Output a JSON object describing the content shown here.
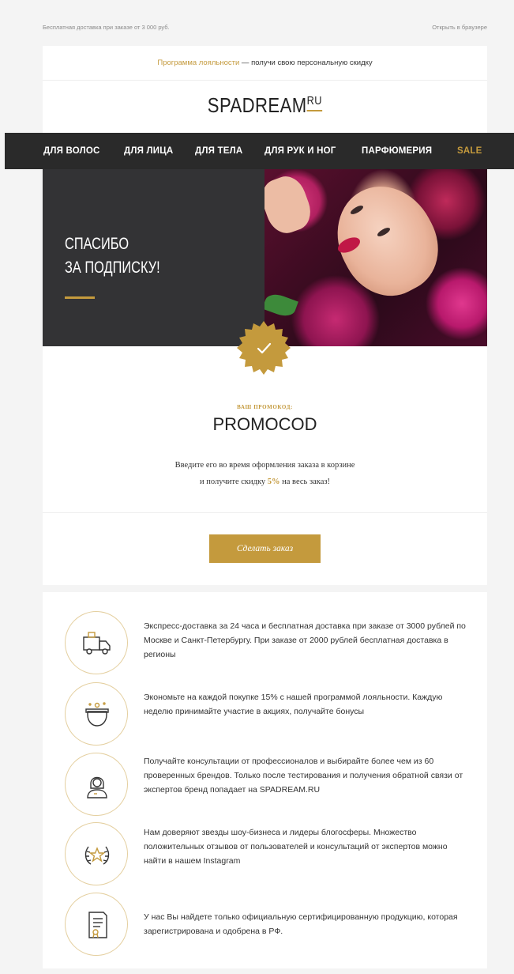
{
  "preheader": {
    "left": "Бесплатная доставка при заказе от 3 000 руб.",
    "right": "Открыть в браузере"
  },
  "loyalty": {
    "link": "Программа лояльности",
    "text": " — получи свою персональную скидку"
  },
  "brand": {
    "name": "SPADREAM",
    "suffix": "RU"
  },
  "nav": {
    "items": [
      "ДЛЯ ВОЛОС",
      "ДЛЯ ЛИЦА",
      "ДЛЯ ТЕЛА",
      "ДЛЯ РУК И НОГ",
      "ПАРФЮМЕРИЯ",
      "SALE"
    ]
  },
  "hero": {
    "line1": "СПАСИБО",
    "line2": "ЗА ПОДПИСКУ!"
  },
  "promo": {
    "label": "ВАШ ПРОМОКОД:",
    "code": "PROMOCOD",
    "text_line1": "Введите его во время оформления заказа в корзине",
    "text_line2_before": "и получите скидку ",
    "discount": "5%",
    "text_line2_after": " на весь заказ!",
    "cta": "Сделать заказ"
  },
  "features": [
    {
      "icon": "delivery-truck-icon",
      "text": "Экспресс-доставка за 24 часа и бесплатная доставка при заказе от 3000 рублей по Москве и Санкт-Петербургу. При заказе от 2000 рублей бесплатная доставка в регионы"
    },
    {
      "icon": "piggy-bank-icon",
      "text": "Экономьте на каждой покупке 15% с нашей программой лояльности. Каждую неделю принимайте участие в акциях, получайте бонусы"
    },
    {
      "icon": "consultant-icon",
      "text": "Получайте консультации от профессионалов и выбирайте более чем из 60 проверенных брендов. Только после тестирования и получения обратной связи от экспертов бренд попадает на SPADREAM.RU"
    },
    {
      "icon": "laurel-star-icon",
      "text": "Нам доверяют звезды шоу-бизнеса и лидеры блогосферы. Множество положительных отзывов от пользователей и консультаций от экспертов можно найти в нашем Instagram"
    },
    {
      "icon": "certificate-icon",
      "text": "У нас Вы найдете только официальную сертифицированную продукцию, которая зарегистрирована и одобрена в РФ."
    }
  ],
  "colors": {
    "accent": "#c49a3d",
    "nav_bg": "#2a2a2a",
    "hero_bg": "#333335"
  }
}
